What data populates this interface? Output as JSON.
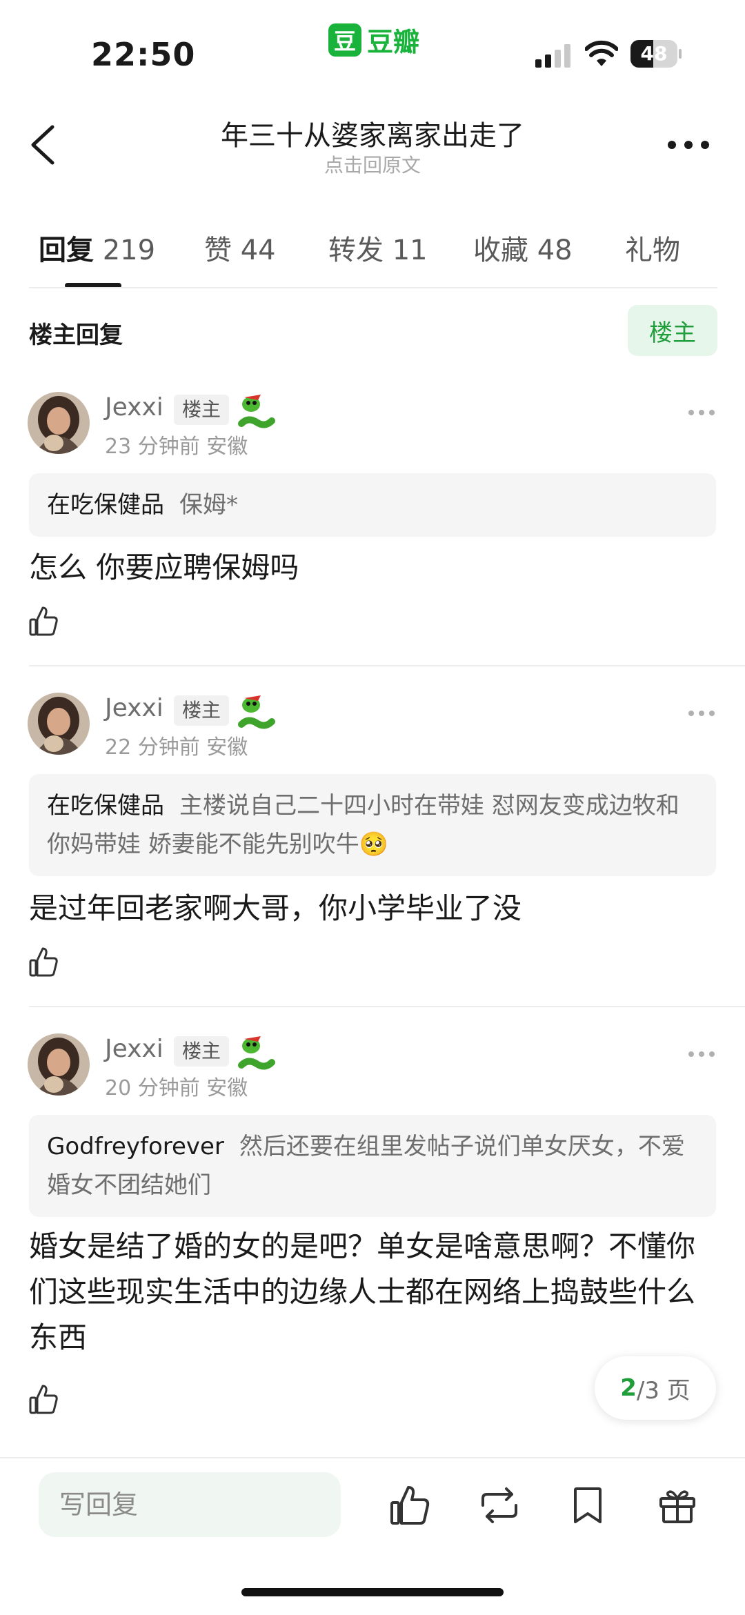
{
  "status_bar": {
    "time": "22:50",
    "app_logo_glyph": "豆",
    "app_logo_text": "豆瓣",
    "battery_level": "48",
    "battery_fraction": 0.48
  },
  "nav": {
    "title": "年三十从婆家离家出走了",
    "subtitle": "点击回原文"
  },
  "tabs": [
    {
      "label": "回复",
      "count": "219"
    },
    {
      "label": "赞",
      "count": "44"
    },
    {
      "label": "转发",
      "count": "11"
    },
    {
      "label": "收藏",
      "count": "48"
    },
    {
      "label": "礼物",
      "count": ""
    }
  ],
  "section": {
    "title": "楼主回复",
    "owner_filter_label": "楼主"
  },
  "comments": [
    {
      "user": "Jexxi",
      "badge": "楼主",
      "time": "23 分钟前",
      "location": "安徽",
      "quote_author": "在吃保健品",
      "quote_text": "保姆*",
      "body": "怎么 你要应聘保姆吗"
    },
    {
      "user": "Jexxi",
      "badge": "楼主",
      "time": "22 分钟前",
      "location": "安徽",
      "quote_author": "在吃保健品",
      "quote_text": "主楼说自己二十四小时在带娃 怼网友变成边牧和你妈带娃 娇妻能不能先别吹牛🥺",
      "body": "是过年回老家啊大哥，你小学毕业了没"
    },
    {
      "user": "Jexxi",
      "badge": "楼主",
      "time": "20 分钟前",
      "location": "安徽",
      "quote_author": "Godfreyforever",
      "quote_text": "然后还要在组里发帖子说们单女厌女，不爱婚女不团结她们",
      "body": "婚女是结了婚的女的是吧？单女是啥意思啊？不懂你们这些现实生活中的边缘人士都在网络上捣鼓些什么东西"
    }
  ],
  "pagination": {
    "current": "2",
    "total_label": "/3 页"
  },
  "bottom_bar": {
    "reply_placeholder": "写回复"
  },
  "colors": {
    "brand_green": "#19b33c",
    "accent_green": "#1f9e3a",
    "owner_badge_bg": "#e6f6ea"
  }
}
